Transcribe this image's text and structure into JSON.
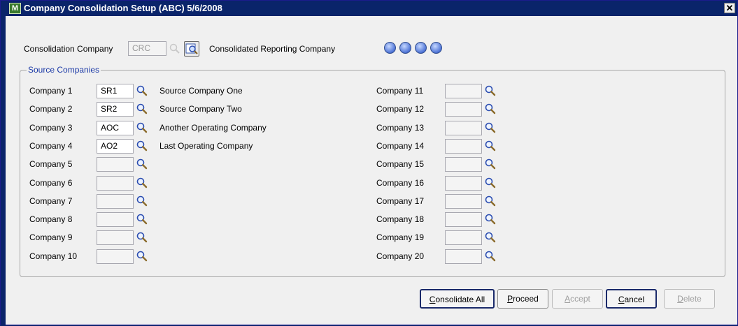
{
  "window": {
    "title": "Company Consolidation Setup (ABC) 5/6/2008",
    "close_glyph": "✕",
    "app_icon_letter": "M"
  },
  "header": {
    "consolidation_company_label": "Consolidation Company",
    "consolidation_company_value": "CRC",
    "consolidated_reporting_company_label": "Consolidated Reporting Company"
  },
  "source_companies": {
    "title": "Source Companies",
    "left": [
      {
        "label": "Company 1",
        "code": "SR1",
        "name": "Source Company One"
      },
      {
        "label": "Company 2",
        "code": "SR2",
        "name": "Source Company Two"
      },
      {
        "label": "Company 3",
        "code": "AOC",
        "name": "Another Operating Company"
      },
      {
        "label": "Company 4",
        "code": "AO2",
        "name": "Last Operating Company"
      },
      {
        "label": "Company 5",
        "code": "",
        "name": ""
      },
      {
        "label": "Company 6",
        "code": "",
        "name": ""
      },
      {
        "label": "Company 7",
        "code": "",
        "name": ""
      },
      {
        "label": "Company 8",
        "code": "",
        "name": ""
      },
      {
        "label": "Company 9",
        "code": "",
        "name": ""
      },
      {
        "label": "Company 10",
        "code": "",
        "name": ""
      }
    ],
    "right": [
      {
        "label": "Company 11",
        "code": ""
      },
      {
        "label": "Company 12",
        "code": ""
      },
      {
        "label": "Company 13",
        "code": ""
      },
      {
        "label": "Company 14",
        "code": ""
      },
      {
        "label": "Company 15",
        "code": ""
      },
      {
        "label": "Company 16",
        "code": ""
      },
      {
        "label": "Company 17",
        "code": ""
      },
      {
        "label": "Company 18",
        "code": ""
      },
      {
        "label": "Company 19",
        "code": ""
      },
      {
        "label": "Company 20",
        "code": ""
      }
    ]
  },
  "buttons": {
    "consolidate_all": {
      "mnemonic": "C",
      "rest": "onsolidate All"
    },
    "proceed": {
      "mnemonic": "P",
      "rest": "roceed"
    },
    "accept": {
      "mnemonic": "A",
      "rest": "ccept"
    },
    "cancel": {
      "mnemonic": "C",
      "rest": "ancel"
    },
    "delete": {
      "mnemonic": "D",
      "rest": "elete"
    }
  },
  "icons": {
    "app": "app-icon",
    "lookup": "magnifier-icon",
    "nav": [
      "first-record-icon",
      "previous-record-icon",
      "next-record-icon",
      "last-record-icon"
    ]
  },
  "colors": {
    "title_bar": "#0a246a",
    "group_title": "#1c3aa6",
    "dialog": "#f0f0f0"
  }
}
